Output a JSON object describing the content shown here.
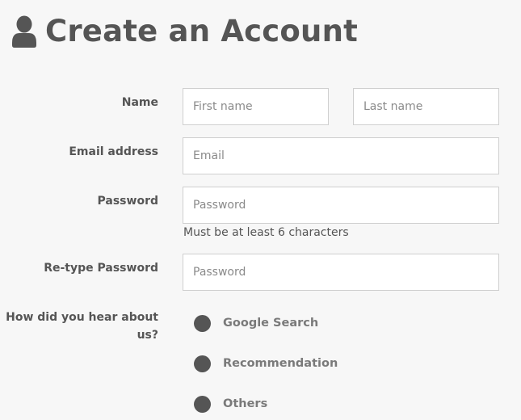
{
  "header": {
    "icon": "user-icon",
    "title": "Create an Account"
  },
  "form": {
    "name": {
      "label": "Name",
      "first_placeholder": "First name",
      "last_placeholder": "Last name",
      "first_value": "",
      "last_value": ""
    },
    "email": {
      "label": "Email address",
      "placeholder": "Email",
      "value": ""
    },
    "password": {
      "label": "Password",
      "placeholder": "Password",
      "value": "",
      "hint": "Must be at least 6 characters"
    },
    "retype_password": {
      "label": "Re-type Password",
      "placeholder": "Password",
      "value": ""
    },
    "referral": {
      "label": "How did you hear about us?",
      "options": [
        "Google Search",
        "Recommendation",
        "Others"
      ]
    }
  },
  "colors": {
    "background": "#f7f7f7",
    "text": "#555555",
    "input_border": "#cfcfcf",
    "radio_fill": "#555555",
    "radio_label": "#7a7a7a"
  }
}
